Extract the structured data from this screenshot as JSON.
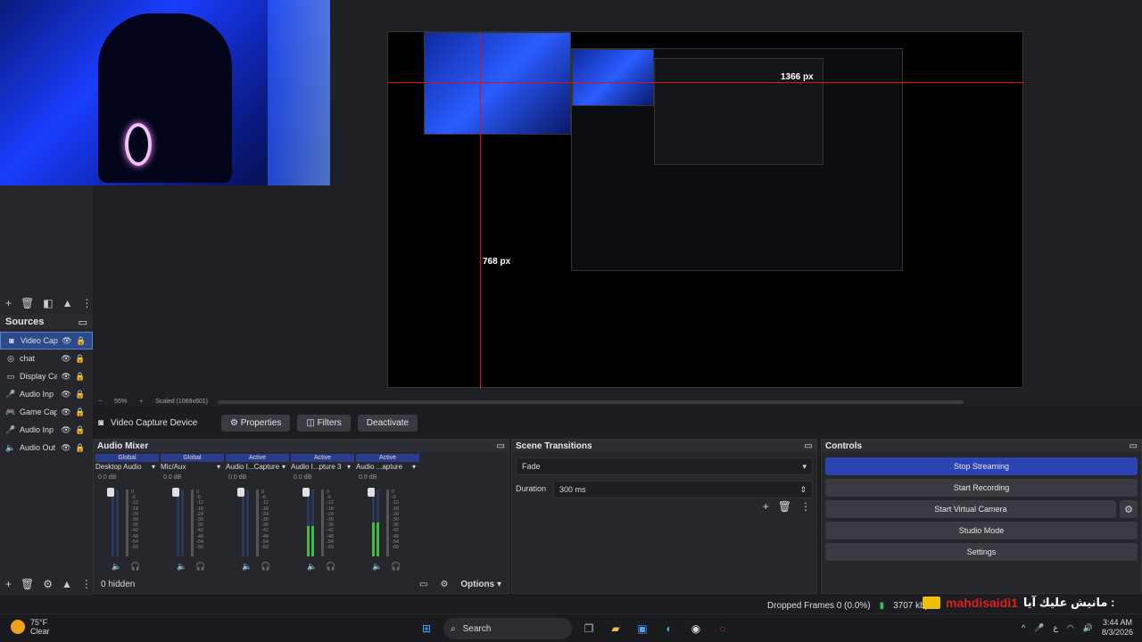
{
  "window": {
    "min": "—",
    "max": "❐",
    "close": "✕"
  },
  "preview": {
    "width_label": "1366 px",
    "height_label": "768 px",
    "zoom": "55%",
    "scale": "Scaled (1069x601)"
  },
  "sources": {
    "title": "Sources",
    "items": [
      {
        "label": "Video Cap",
        "icon": "camera-icon"
      },
      {
        "label": "chat",
        "icon": "globe-icon"
      },
      {
        "label": "Display Ca",
        "icon": "monitor-icon"
      },
      {
        "label": "Audio Inp",
        "icon": "mic-icon"
      },
      {
        "label": "Game Cap",
        "icon": "gamepad-icon"
      },
      {
        "label": "Audio Inp",
        "icon": "mic-icon"
      },
      {
        "label": "Audio Out",
        "icon": "speaker-icon"
      }
    ]
  },
  "context": {
    "source": "Video Capture Device",
    "properties": "Properties",
    "filters": "Filters",
    "deactivate": "Deactivate"
  },
  "mixer": {
    "title": "Audio Mixer",
    "channels": [
      {
        "tag": "Global",
        "name": "Desktop Audio",
        "db": "0.0 dB",
        "level": 0
      },
      {
        "tag": "Global",
        "name": "Mic/Aux",
        "db": "0.0 dB",
        "level": 0
      },
      {
        "tag": "Active",
        "name": "Audio I...Capture",
        "db": "0.0 dB",
        "level": 0
      },
      {
        "tag": "Active",
        "name": "Audio I...pture 3",
        "db": "0.0 dB",
        "level": 0.45
      },
      {
        "tag": "Active",
        "name": "Audio ...apture",
        "db": "0.0 dB",
        "level": 0.5
      }
    ],
    "scale": [
      "0",
      "-6",
      "-12",
      "-18",
      "-24",
      "-30",
      "-36",
      "-42",
      "-48",
      "-54",
      "-60"
    ],
    "hidden": "0 hidden",
    "options": "Options"
  },
  "transitions": {
    "title": "Scene Transitions",
    "selected": "Fade",
    "duration_label": "Duration",
    "duration": "300 ms"
  },
  "controls": {
    "title": "Controls",
    "stop_streaming": "Stop Streaming",
    "start_recording": "Start Recording",
    "start_virtual": "Start Virtual Camera",
    "studio_mode": "Studio Mode",
    "settings": "Settings"
  },
  "status": {
    "dropped": "Dropped Frames 0 (0.0%)",
    "kbps": "3707 kbps"
  },
  "overlay": {
    "text": "مانيش عليك آيا :",
    "user": "mahdisaidi1"
  },
  "taskbar": {
    "temp": "75°F",
    "weather": "Clear",
    "search": "Search",
    "time": "3:44 AM",
    "date": "8/3/2026"
  },
  "colors": {
    "accent": "#2b44b4",
    "selected": "#2d4a8a",
    "meter_green": "#3fbf3f",
    "red": "#d11"
  }
}
